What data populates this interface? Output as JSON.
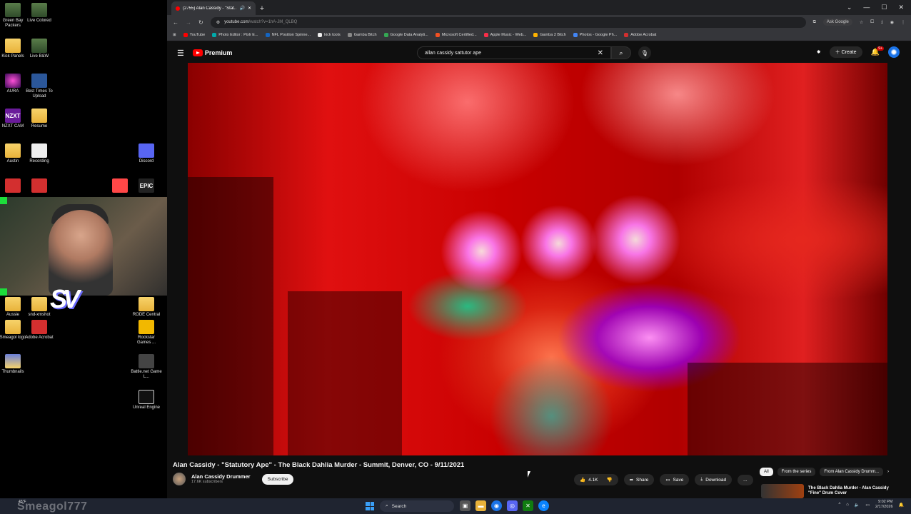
{
  "desktop": {
    "icons": [
      {
        "label": "Green Bay Packers",
        "glyph": "img"
      },
      {
        "label": "Live Colored",
        "glyph": "img"
      },
      {
        "label": "Kick Panels",
        "glyph": "folder"
      },
      {
        "label": "Live B&W",
        "glyph": "img"
      },
      {
        "label": "AURA",
        "glyph": "aura"
      },
      {
        "label": "Best Times To Upload",
        "glyph": "word"
      },
      {
        "label": "NZXT CAM",
        "glyph": "nzxt"
      },
      {
        "label": "Resume",
        "glyph": "folder"
      },
      {
        "label": "Austin",
        "glyph": "folder"
      },
      {
        "label": "Recording",
        "glyph": "rec"
      },
      {
        "label": "Discord",
        "glyph": "discord"
      },
      {
        "label": "",
        "glyph": "pdf"
      },
      {
        "label": "",
        "glyph": "pdf"
      },
      {
        "label": "",
        "glyph": "ea"
      },
      {
        "label": "",
        "glyph": "epic"
      },
      {
        "label": "Aussie",
        "glyph": "folder"
      },
      {
        "label": "snd-xmshot",
        "glyph": "folder"
      },
      {
        "label": "RODE Central",
        "glyph": "folder"
      },
      {
        "label": "Smeagol logo",
        "glyph": "folder"
      },
      {
        "label": "Adobe Acrobat",
        "glyph": "pdf"
      },
      {
        "label": "Rockstar Games ...",
        "glyph": "rock"
      },
      {
        "label": "Thumbnails",
        "glyph": "thumb"
      },
      {
        "label": "Battle.net Game L...",
        "glyph": "bnet"
      },
      {
        "label": "Unreal Engine",
        "glyph": "unreal"
      }
    ],
    "epic_text": "EPIC",
    "nzxt_text": "NZXT"
  },
  "browser": {
    "tab_title": "(2755) Alan Cassidy - \"Stat...",
    "new_tab": "+",
    "window_controls": [
      "⌄",
      "—",
      "☐",
      "✕"
    ],
    "url_host": "youtube.com",
    "url_path": "/watch?v=1hA-JM_QLBQ",
    "ask_google": "Ask Google",
    "bookmarks": [
      "YouTube",
      "Photo Editor : Pixlr E...",
      "NFL Position Spinne...",
      "kick tools",
      "Gamba Bitch",
      "Google Data Analyti...",
      "Microsoft Certified...",
      "Apple Music - Web...",
      "Gamba 2 Bitch",
      "Photos - Google Ph...",
      "Adobe Acrobat"
    ]
  },
  "youtube": {
    "logo_text": "Premium",
    "search_value": "allan cassidy sattutor ape",
    "create_label": "Create",
    "notif_count": "9+",
    "video_title": "Alan Cassidy - \"Statutory Ape\" - The Black Dahlia Murder - Summit, Denver, CO - 9/11/2021",
    "channel_name": "Alan Cassidy Drummer",
    "channel_subs": "17.6K subscribers",
    "subscribe_label": "Subscribe",
    "like_count": "4.1K",
    "share_label": "Share",
    "save_label": "Save",
    "download_label": "Download",
    "more_label": "...",
    "chips": [
      "All",
      "From the series",
      "From Alan Cassidy Drumm..."
    ],
    "rec_title": "The Black Dahlia Murder - Alan Cassidy \"Fine\" Drum Cover"
  },
  "taskbar": {
    "watermark": "Smeagol777",
    "weather": "45°F",
    "search_label": "Search",
    "time": "9:02 PM",
    "date": "2/17/2026"
  }
}
